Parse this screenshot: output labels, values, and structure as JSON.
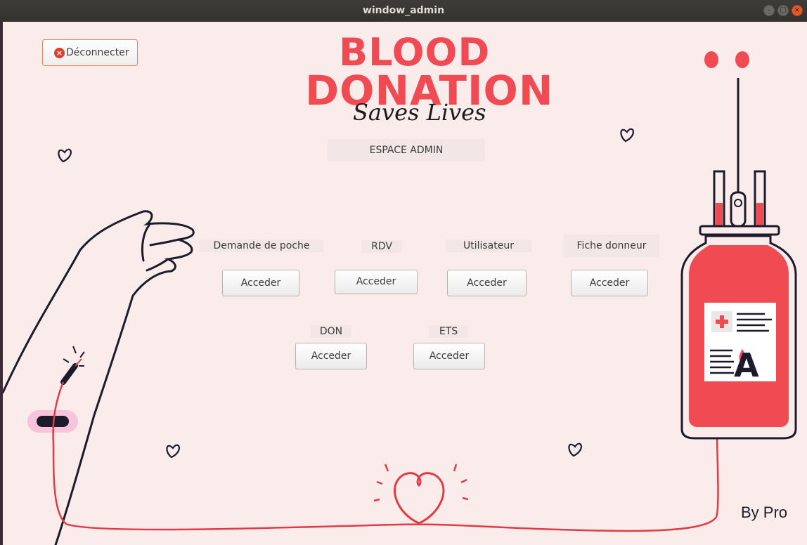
{
  "window": {
    "title": "window_admin"
  },
  "header": {
    "logout_label": "Déconnecter",
    "brand_line1": "BLOOD",
    "brand_line2": "DONATION",
    "brand_tagline": "Saves Lives",
    "section_label": "ESPACE ADMIN"
  },
  "modules": [
    {
      "label": "Demande de poche",
      "button": "Acceder"
    },
    {
      "label": "RDV",
      "button": "Acceder"
    },
    {
      "label": "Utilisateur",
      "button": "Acceder"
    },
    {
      "label": "Fiche donneur",
      "button": "Acceder"
    },
    {
      "label": "DON",
      "button": "Acceder"
    },
    {
      "label": "ETS",
      "button": "Acceder"
    }
  ],
  "bag": {
    "blood_type": "A"
  },
  "footer": {
    "credit": "By Pro"
  },
  "colors": {
    "accent": "#f04a53",
    "background": "#fbecec",
    "ink": "#1f1f2b"
  }
}
